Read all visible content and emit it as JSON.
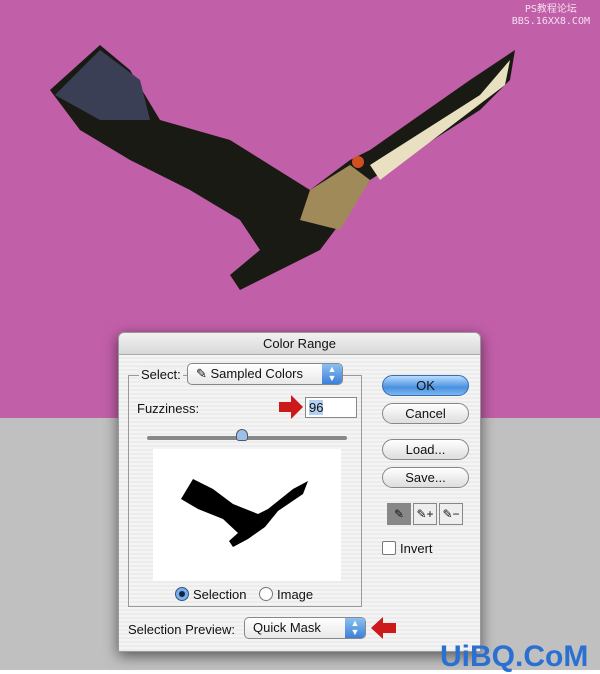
{
  "watermark": {
    "line1": "PS教程论坛",
    "line2": "BBS.16XX8.COM"
  },
  "dialog": {
    "title": "Color Range",
    "select_label": "Select:",
    "select_value": "Sampled Colors",
    "fuzziness_label": "Fuzziness:",
    "fuzziness_value": "96",
    "fuzziness_percent": 48,
    "radio_selection": "Selection",
    "radio_image": "Image",
    "radio_selected": "Selection",
    "preview_label": "Selection Preview:",
    "preview_value": "Quick Mask",
    "buttons": {
      "ok": "OK",
      "cancel": "Cancel",
      "load": "Load...",
      "save": "Save..."
    },
    "invert_label": "Invert",
    "invert_checked": false,
    "tools": [
      "eyedropper-icon",
      "eyedropper-plus-icon",
      "eyedropper-minus-icon"
    ]
  },
  "colors": {
    "background_top": "#c25fa9",
    "background_bottom": "#c0c0c0",
    "arrow": "#cc1a1a",
    "accent": "#3b80d8"
  },
  "footer_logo": "UiBQ.CoM"
}
